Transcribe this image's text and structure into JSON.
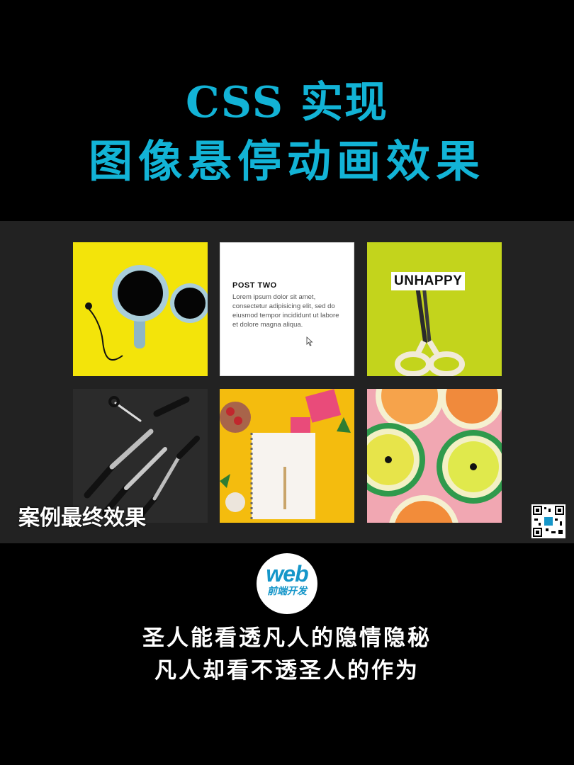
{
  "header": {
    "title_line1": "CSS 实现",
    "title_line2": "图像悬停动画效果"
  },
  "demo": {
    "tiles": [
      {
        "name": "coffee-cups-image",
        "bg": "#f3e40a"
      },
      {
        "name": "post-card",
        "bg": "#ffffff"
      },
      {
        "name": "unhappy-scissors-image",
        "bg": "#c3d41c"
      },
      {
        "name": "kitchen-knives-image",
        "bg": "#2b2b2b"
      },
      {
        "name": "notebook-gifts-image",
        "bg": "#f4bc0e"
      },
      {
        "name": "citrus-slices-image",
        "bg": "#f1a7b2"
      }
    ],
    "post": {
      "title": "POST TWO",
      "body": "Lorem ipsum dolor sit amet, consectetur adipisicing elit, sed do eiusmod tempor incididunt ut labore et dolore magna aliqua."
    },
    "scissors_label": "UNHAPPY",
    "caption": "案例最终效果"
  },
  "logo": {
    "main": "web",
    "sub": "前端开发"
  },
  "quote": {
    "line1": "圣人能看透凡人的隐情隐秘",
    "line2": "凡人却看不透圣人的作为"
  },
  "colors": {
    "title_accent": "#12b3d6",
    "logo_blue": "#1596c9",
    "panel_bg": "#222222"
  }
}
